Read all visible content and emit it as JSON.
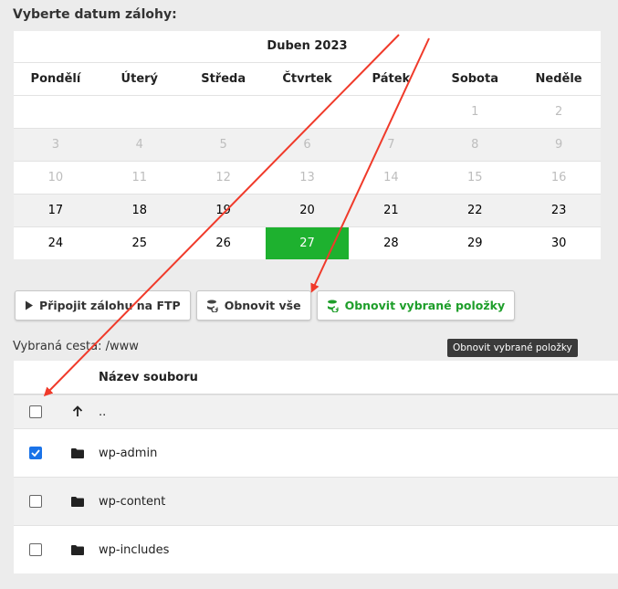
{
  "heading": "Vyberte datum zálohy:",
  "calendar": {
    "month": "Duben 2023",
    "weekdays": [
      "Pondělí",
      "Úterý",
      "Středa",
      "Čtvrtek",
      "Pátek",
      "Sobota",
      "Neděle"
    ],
    "weeks": [
      [
        "",
        "",
        "",
        "",
        "",
        "1",
        "2"
      ],
      [
        "3",
        "4",
        "5",
        "6",
        "7",
        "8",
        "9"
      ],
      [
        "10",
        "11",
        "12",
        "13",
        "14",
        "15",
        "16"
      ],
      [
        "17",
        "18",
        "19",
        "20",
        "21",
        "22",
        "23"
      ],
      [
        "24",
        "25",
        "26",
        "27",
        "28",
        "29",
        "30"
      ]
    ],
    "selected_day": "27",
    "first_available_day": 17
  },
  "toolbar": {
    "ftp_label": "Připojit zálohu na FTP",
    "restore_all_label": "Obnovit vše",
    "restore_selected_label": "Obnovit vybrané položky"
  },
  "tooltip": "Obnovit vybrané položky",
  "path_label": "Vybraná cesta: /www",
  "files": {
    "column_name": "Název souboru",
    "parent": "..",
    "items": [
      {
        "name": "wp-admin",
        "checked": true
      },
      {
        "name": "wp-content",
        "checked": false
      },
      {
        "name": "wp-includes",
        "checked": false
      }
    ]
  },
  "colors": {
    "selected_day": "#1eb12f",
    "restore_selected_text": "#1e9e2a",
    "checkbox_checked": "#1a73e8",
    "annotation_arrow": "#f03a2a"
  }
}
